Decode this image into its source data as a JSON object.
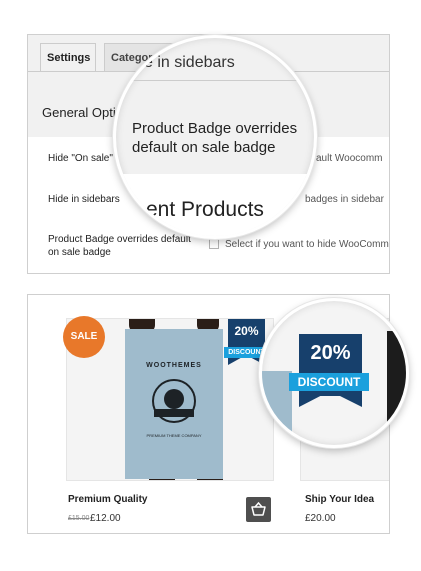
{
  "settings": {
    "tabs": [
      {
        "label": "Settings"
      },
      {
        "label": "Category"
      }
    ],
    "section_title": "General Optio",
    "fields": [
      {
        "label": "Hide \"On sale\" l",
        "description": "ault Woocomm"
      },
      {
        "label": "Hide in sidebars",
        "description": "badges in sidebar"
      },
      {
        "label": "Product Badge overrides default on sale badge",
        "description": "Select if you want to hide WooComm"
      }
    ],
    "magnifier": {
      "line1": "e in sidebars",
      "line2": "Product Badge overrides default on sale badge",
      "line3": "ent Products"
    }
  },
  "products": {
    "items": [
      {
        "title": "Premium Quality",
        "old_price": "£15.00",
        "price": "£12.00",
        "sale_badge": "SALE",
        "discount_percent": "20%",
        "discount_label": "DISCOUNT",
        "poster_title": "WOOTHEMES",
        "poster_subtitle": "PREMIUM THEME COMPANY"
      },
      {
        "title": "Ship Your Idea",
        "price": "£20.00"
      }
    ],
    "magnifier": {
      "discount_percent": "20%",
      "discount_label": "DISCOUNT"
    }
  },
  "colors": {
    "sale_badge": "#e8782a",
    "discount_banner": "#17406c",
    "discount_ribbon": "#1ba0dd",
    "poster": "#9fbbcc"
  },
  "icons": {
    "cart": "basket-icon"
  }
}
